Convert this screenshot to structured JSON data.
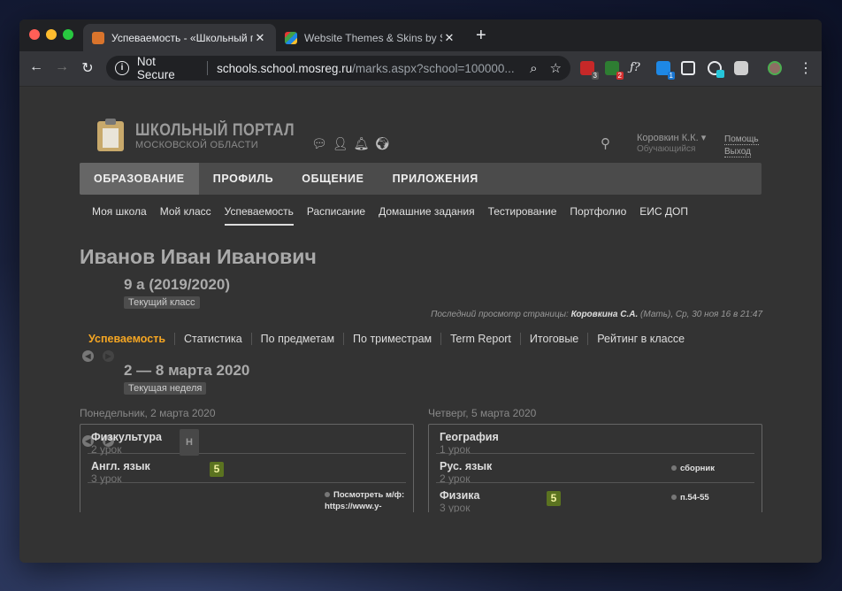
{
  "browser": {
    "tabs": [
      {
        "title": "Успеваемость - «Школьный п",
        "active": true,
        "favicon_color": "#d9742c"
      },
      {
        "title": "Website Themes & Skins by Sty",
        "active": false,
        "favicon_color": "#4caf50"
      }
    ],
    "new_tab_icon": "+",
    "security": "Not Secure",
    "url_host": "schools.school.mosreg.ru",
    "url_path": "/marks.aspx?school=100000...",
    "extensions": [
      {
        "name": "abp-icon",
        "badge": "3",
        "color": "#c62828"
      },
      {
        "name": "download-icon",
        "badge": "2",
        "color": "#2e7d32"
      },
      {
        "name": "fx-icon",
        "badge": "",
        "color": "#e8eaed"
      },
      {
        "name": "skype-icon",
        "badge": "1",
        "color": "#1e88e5"
      },
      {
        "name": "screenshot-icon",
        "badge": "",
        "color": "#e8eaed"
      },
      {
        "name": "stylus-icon",
        "badge": "",
        "color": "#26c6da"
      },
      {
        "name": "storage-icon",
        "badge": "",
        "color": "#cfcfcf"
      },
      {
        "name": "profile-avatar",
        "badge": "",
        "color": "#8d6e63"
      }
    ]
  },
  "header": {
    "logo_title": "ШКОЛЬНЫЙ ПОРТАЛ",
    "logo_subtitle": "МОСКОВСКОЙ ОБЛАСТИ",
    "user_name": "Коровкин К.К.",
    "user_role": "Обучающийся",
    "help": "Помощь",
    "logout": "Выход"
  },
  "main_nav": [
    "ОБРАЗОВАНИЕ",
    "ПРОФИЛЬ",
    "ОБЩЕНИЕ",
    "ПРИЛОЖЕНИЯ"
  ],
  "sub_nav": [
    "Моя школа",
    "Мой класс",
    "Успеваемость",
    "Расписание",
    "Домашние задания",
    "Тестирование",
    "Портфолио",
    "ЕИС ДОП"
  ],
  "student": {
    "name": "Иванов Иван Иванович",
    "class": "9 а (2019/2020)",
    "class_badge": "Текущий класс",
    "last_view_prefix": "Последний просмотр страницы: ",
    "last_view_name": "Коровкина С.А.",
    "last_view_suffix": " (Мать), Ср, 30 ноя 16 в 21:47"
  },
  "mark_tabs": [
    "Успеваемость",
    "Статистика",
    "По предметам",
    "По триместрам",
    "Term Report",
    "Итоговые",
    "Рейтинг в классе"
  ],
  "week": {
    "range": "2 — 8 марта 2020",
    "badge": "Текущая неделя"
  },
  "days": [
    {
      "title": "Понедельник, 2 марта 2020",
      "lessons": [
        {
          "subject": "Физкультура",
          "number": "2 урок",
          "absent": "Н"
        },
        {
          "subject": "Англ. язык",
          "number": "3 урок",
          "grade": "5"
        },
        {
          "subject": "",
          "number": "",
          "homework": "Посмотреть м/ф: https://www.y-"
        }
      ]
    },
    {
      "title": "Четверг, 5 марта 2020",
      "lessons": [
        {
          "subject": "География",
          "number": "1 урок"
        },
        {
          "subject": "Рус. язык",
          "number": "2 урок",
          "homework": "сборник"
        },
        {
          "subject": "Физика",
          "number": "3 урок",
          "grade": "5",
          "homework": "п.54-55"
        }
      ]
    }
  ]
}
